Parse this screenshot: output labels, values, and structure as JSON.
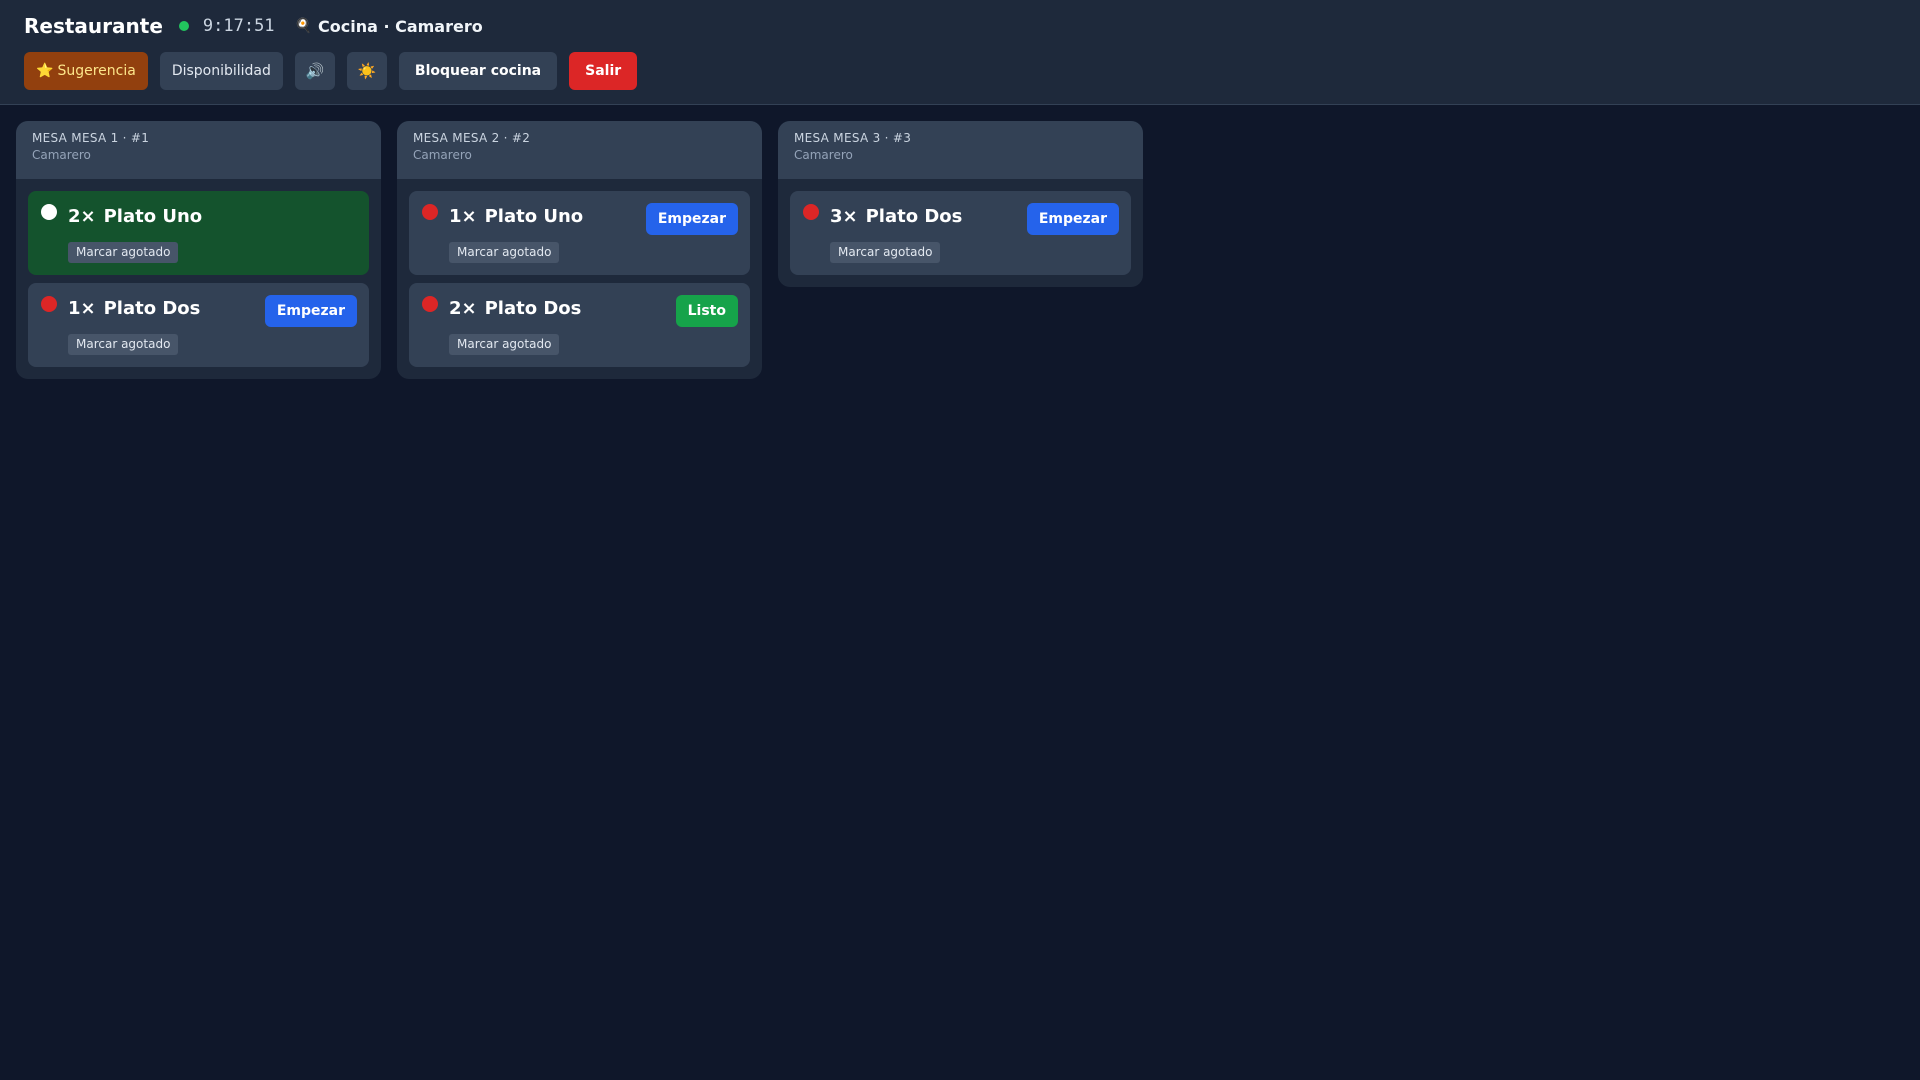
{
  "header": {
    "title": "Restaurante",
    "clock": "9:17:51",
    "station_icon": "🍳",
    "station": "Cocina · Camarero",
    "status_color": "#22c55e"
  },
  "toolbar": {
    "suggest_icon": "⭐",
    "suggest_label": "Sugerencia",
    "availability_label": "Disponibilidad",
    "sound_icon": "🔊",
    "theme_icon": "☀️",
    "lock_label": "Bloquear cocina",
    "exit_label": "Salir"
  },
  "orders": [
    {
      "title": "MESA MESA 1 · #1",
      "subtitle": "Camarero",
      "items": [
        {
          "qty": "2×",
          "name": "Plato Uno",
          "tag": "Marcar agotado",
          "state": "started",
          "action": ""
        },
        {
          "qty": "1×",
          "name": "Plato Dos",
          "tag": "Marcar agotado",
          "state": "pending",
          "action": "Empezar"
        }
      ]
    },
    {
      "title": "MESA MESA 2 · #2",
      "subtitle": "Camarero",
      "items": [
        {
          "qty": "1×",
          "name": "Plato Uno",
          "tag": "Marcar agotado",
          "state": "pending",
          "action": "Empezar"
        },
        {
          "qty": "2×",
          "name": "Plato Dos",
          "tag": "Marcar agotado",
          "state": "pending",
          "action": "Listo"
        }
      ]
    },
    {
      "title": "MESA MESA 3 · #3",
      "subtitle": "Camarero",
      "items": [
        {
          "qty": "3×",
          "name": "Plato Dos",
          "tag": "Marcar agotado",
          "state": "pending",
          "action": "Empezar"
        }
      ]
    }
  ],
  "colors": {
    "background": "#0f172a",
    "panel": "#1e293b",
    "pending_dot": "#dc2626",
    "started_row": "#14532d",
    "start_button": "#2563eb",
    "ready_button": "#16a34a",
    "exit_button": "#dc2626"
  }
}
